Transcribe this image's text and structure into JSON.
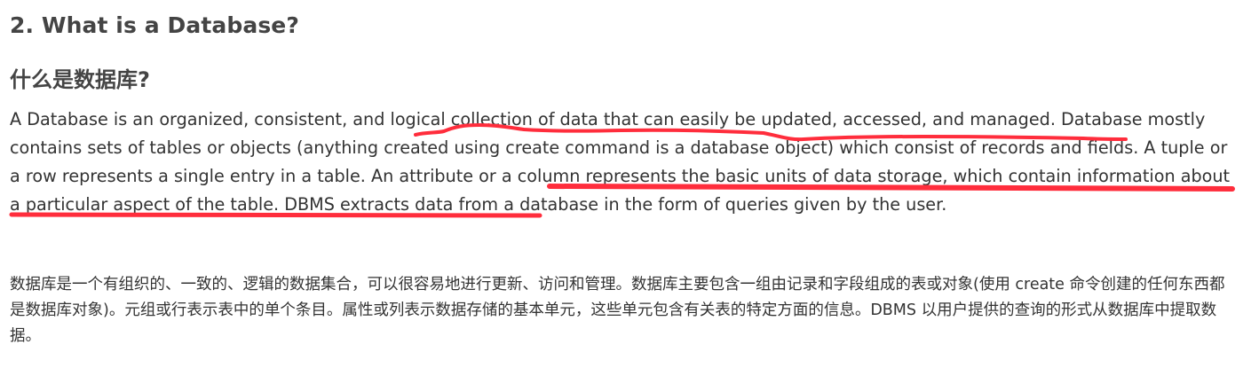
{
  "article": {
    "title_en": "2. What is a Database?",
    "title_zh": "什么是数据库?",
    "para_en": {
      "s1_pre": "A Database is an organized, consistent, and ",
      "s1_hl": "logical collection of data that can easily be updated, accessed, and managed",
      "s1_post": ". Database mostly contains sets of tables or objects (anything created using create command is a database object) which consist of records and fields. A tuple or a row represents a single entry in a table. ",
      "s2_hl": "An attribute or a column represents the basic units of data storage, which contain information about a particular aspect of the table",
      "s2_post": ". DBMS extracts data from a database in the form of queries given by the user."
    },
    "para_zh": "数据库是一个有组织的、一致的、逻辑的数据集合，可以很容易地进行更新、访问和管理。数据库主要包含一组由记录和字段组成的表或对象(使用 create 命令创建的任何东西都是数据库对象)。元组或行表示表中的单个条目。属性或列表示数据存储的基本单元，这些单元包含有关表的特定方面的信息。DBMS 以用户提供的查询的形式从数据库中提取数据。"
  },
  "annotation": {
    "color": "#ff2d3c"
  }
}
